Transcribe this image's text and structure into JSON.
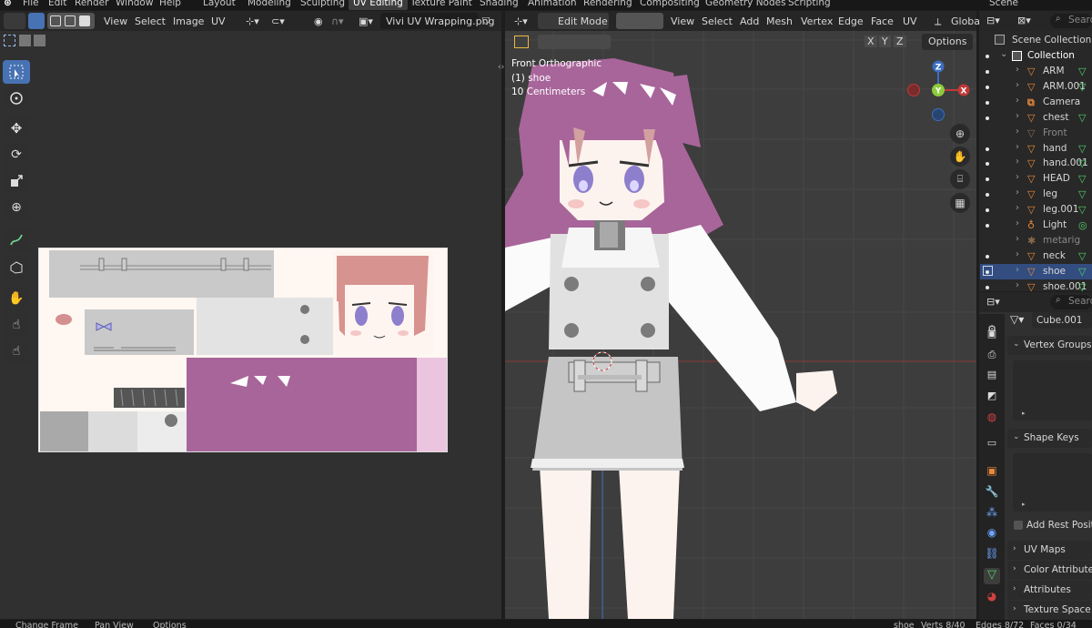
{
  "top_menu": [
    "File",
    "Edit",
    "Render",
    "Window",
    "Help"
  ],
  "workspaces": [
    "Layout",
    "Modeling",
    "Sculpting",
    "UV Editing",
    "Texture Paint",
    "Shading",
    "Animation",
    "Rendering",
    "Compositing",
    "Geometry Nodes",
    "Scripting"
  ],
  "active_workspace": "UV Editing",
  "scene_name": "Scene",
  "uv_editor": {
    "menus": [
      "View",
      "Select",
      "Image",
      "UV"
    ],
    "image_name": "Vivi UV Wrapping.png"
  },
  "viewport": {
    "mode": "Edit Mode",
    "menus": [
      "View",
      "Select",
      "Add",
      "Mesh",
      "Vertex",
      "Edge",
      "Face",
      "UV"
    ],
    "orientation": "Globa",
    "axis_toggles": [
      "X",
      "Y",
      "Z"
    ],
    "options_label": "Options",
    "overlay_info": [
      "Front Orthographic",
      "(1) shoe",
      "10 Centimeters"
    ],
    "gizmo_labels": {
      "z": "Z",
      "y": "Y",
      "x": "X"
    }
  },
  "outliner": {
    "search_placeholder": "Search",
    "scene_collection": "Scene Collection",
    "collection": "Collection",
    "items": [
      {
        "name": "ARM",
        "type": "mesh"
      },
      {
        "name": "ARM.001",
        "type": "mesh"
      },
      {
        "name": "Camera",
        "type": "camera"
      },
      {
        "name": "chest",
        "type": "mesh"
      },
      {
        "name": "Front",
        "type": "mesh"
      },
      {
        "name": "hand",
        "type": "mesh"
      },
      {
        "name": "hand.001",
        "type": "mesh"
      },
      {
        "name": "HEAD",
        "type": "mesh"
      },
      {
        "name": "leg",
        "type": "mesh"
      },
      {
        "name": "leg.001",
        "type": "mesh"
      },
      {
        "name": "Light",
        "type": "light"
      },
      {
        "name": "metarig",
        "type": "armature"
      },
      {
        "name": "neck",
        "type": "mesh"
      },
      {
        "name": "shoe",
        "type": "mesh",
        "selected": true
      },
      {
        "name": "shoe.001",
        "type": "mesh"
      }
    ]
  },
  "properties": {
    "search_placeholder": "Search",
    "mesh_name": "Cube.001",
    "sections": [
      "Vertex Groups",
      "Shape Keys",
      "UV Maps",
      "Color Attributes",
      "Attributes",
      "Texture Space"
    ],
    "add_rest_position": "Add Rest Position"
  },
  "status_bar": [
    "Change Frame",
    "Pan View",
    "Options",
    "shoe",
    "Verts 8/40",
    "Edges 8/72",
    "Faces 0/34"
  ],
  "colors": {
    "accent": "#4772b3",
    "selected_row": "#334d80",
    "uv_bg": "#fff7f2",
    "hair": "#a8659a",
    "skin": "#fdf3ee"
  }
}
